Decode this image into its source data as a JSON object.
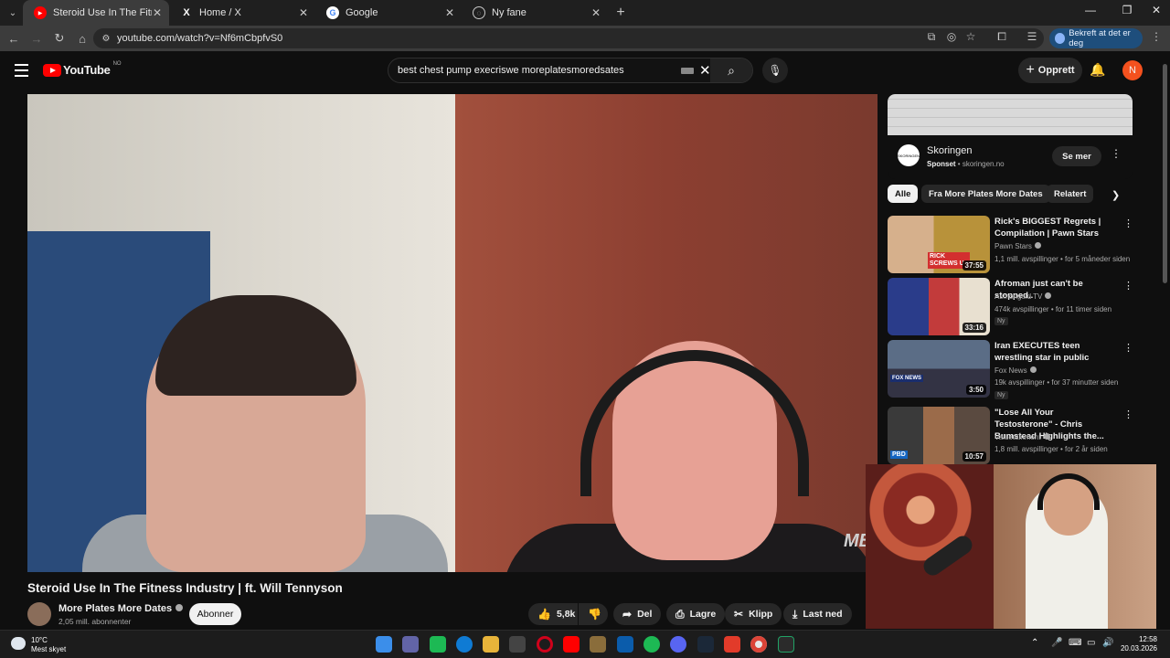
{
  "browser": {
    "tabs": [
      {
        "title": "Steroid Use In The Fitness Indu",
        "icon": "youtube-icon",
        "active": true
      },
      {
        "title": "Home / X",
        "icon": "x-icon",
        "active": false
      },
      {
        "title": "Google",
        "icon": "google-icon",
        "active": false
      },
      {
        "title": "Ny fane",
        "icon": "globe-icon",
        "active": false
      }
    ],
    "url": "youtube.com/watch?v=Nf6mCbpfvS0",
    "profile_button": "Bekreft at det er deg",
    "colors": {
      "tabbar": "#1f1f1f",
      "toolbar": "#3c3c3c",
      "profile": "#1e4e7c"
    }
  },
  "youtube": {
    "logo_text": "YouTube",
    "country_code": "NO",
    "search_query": "best chest pump execriswe moreplatesmoredsates",
    "create_label": "Opprett",
    "avatar_letter": "N",
    "brand_color": "#ff0000"
  },
  "video": {
    "title": "Steroid Use In The Fitness Industry | ft. Will Tennyson",
    "channel": "More Plates More Dates",
    "subscribers": "2,05 mill. abonnenter",
    "subscribe_label": "Abonner",
    "watermark": "MB",
    "actions": {
      "likes": "5,8k",
      "share": "Del",
      "save": "Lagre",
      "clip": "Klipp",
      "download": "Last ned"
    }
  },
  "ad": {
    "name": "Skoringen",
    "sponsored": "Sponset",
    "domain": "skoringen.no",
    "button": "Se mer",
    "logo_text": "SKORINGEN"
  },
  "chips": [
    "Alle",
    "Fra More Plates More Dates",
    "Relatert"
  ],
  "recommendations": [
    {
      "title": "Rick's BIGGEST Regrets | Compilation | Pawn Stars",
      "channel": "Pawn Stars",
      "meta": "1,1 mill. avspillinger • for 5 måneder siden",
      "duration": "37:55",
      "badge": "",
      "thumb_text": "RICK SCREWS U"
    },
    {
      "title": "Afroman just can't be stopped..",
      "channel": "Asmongold TV",
      "meta": "474k avspillinger • for 11 timer siden",
      "duration": "33:16",
      "badge": "Ny",
      "thumb_text": ""
    },
    {
      "title": "Iran EXECUTES teen wrestling star in public",
      "channel": "Fox News",
      "meta": "19k avspillinger • for 37 minutter siden",
      "duration": "3:50",
      "badge": "Ny",
      "thumb_text": "FOX NEWS"
    },
    {
      "title": "\"Lose All Your Testosterone\" - Chris Bumstead Highlights the...",
      "channel": "Valuetainment",
      "meta": "1,8 mill. avspillinger • for 2 år siden",
      "duration": "10:57",
      "badge": "",
      "thumb_text": "PBD"
    }
  ],
  "taskbar": {
    "temperature": "10°C",
    "weather": "Mest skyet",
    "time": "12:58",
    "date": "20.03.2026"
  }
}
